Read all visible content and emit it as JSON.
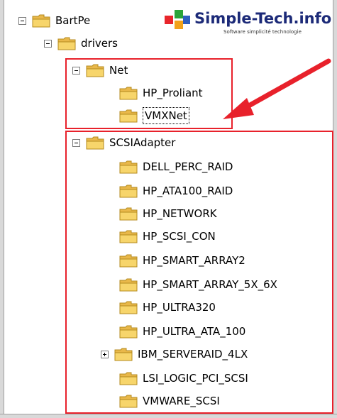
{
  "logo": {
    "name": "Simple-Tech.info",
    "tagline": "Software simplicité technologie"
  },
  "colors": {
    "highlight_red": "#e8212b",
    "folder_yellow": "#f7d56b",
    "logo_text": "#1c2a78"
  },
  "tree": {
    "bartpe": {
      "label": "BartPe",
      "expander": "minus"
    },
    "drivers": {
      "label": "drivers",
      "expander": "minus"
    },
    "net": {
      "label": "Net",
      "expander": "minus",
      "children": [
        "HP_Proliant",
        "VMXNet"
      ]
    },
    "scsi": {
      "label": "SCSIAdapter",
      "expander": "minus",
      "children": [
        {
          "label": "DELL_PERC_RAID",
          "expander": ""
        },
        {
          "label": "HP_ATA100_RAID",
          "expander": ""
        },
        {
          "label": "HP_NETWORK",
          "expander": ""
        },
        {
          "label": "HP_SCSI_CON",
          "expander": ""
        },
        {
          "label": "HP_SMART_ARRAY2",
          "expander": ""
        },
        {
          "label": "HP_SMART_ARRAY_5X_6X",
          "expander": ""
        },
        {
          "label": "HP_ULTRA320",
          "expander": ""
        },
        {
          "label": "HP_ULTRA_ATA_100",
          "expander": ""
        },
        {
          "label": "IBM_SERVERAID_4LX",
          "expander": "plus"
        },
        {
          "label": "LSI_LOGIC_PCI_SCSI",
          "expander": ""
        },
        {
          "label": "VMWARE_SCSI",
          "expander": ""
        }
      ]
    }
  }
}
